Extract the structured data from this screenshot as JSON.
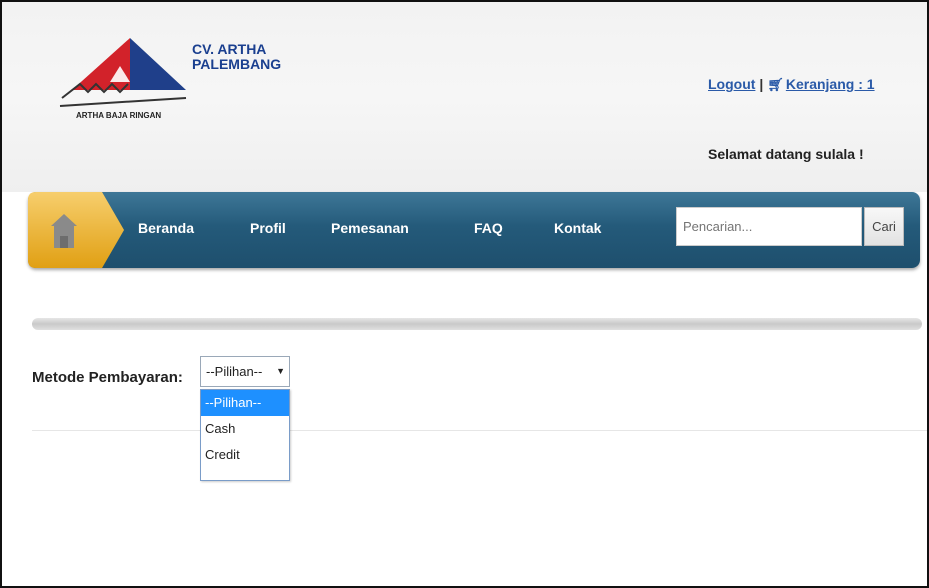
{
  "header": {
    "logo_text": "ARTHA BAJA RINGAN",
    "company_line1": "CV. ARTHA",
    "company_line2": "PALEMBANG",
    "logout_label": "Logout",
    "separator": "|",
    "cart_label": "Keranjang : 1",
    "welcome": "Selamat datang sulala !"
  },
  "nav": {
    "items": [
      {
        "label": "Beranda"
      },
      {
        "label": "Profil"
      },
      {
        "label": "Pemesanan"
      },
      {
        "label": "FAQ"
      },
      {
        "label": "Kontak"
      }
    ],
    "search_placeholder": "Pencarian...",
    "search_button": "Cari"
  },
  "payment": {
    "label": "Metode Pembayaran:",
    "selected": "--Pilihan--",
    "options": [
      "--Pilihan--",
      "Cash",
      "Credit"
    ]
  },
  "colors": {
    "nav_bg": "#245a7a",
    "link": "#2a5aa8",
    "home_tab": "#f2b41e",
    "option_highlight": "#1e90ff"
  },
  "icons": {
    "home": "home-icon",
    "cart": "cart-icon",
    "dropdown": "chevron-down-icon"
  }
}
